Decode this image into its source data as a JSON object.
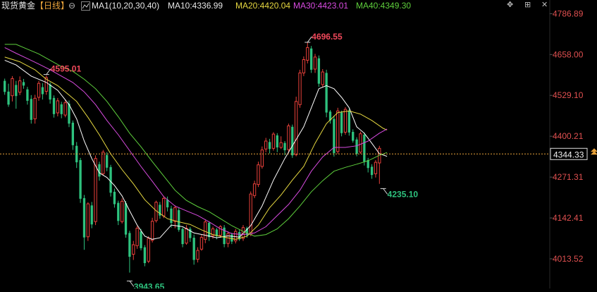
{
  "header": {
    "symbol": "现货黄金",
    "period": "【日线】",
    "period_toggle_glyph": "⊖",
    "indicator_icon": "ma-indicator-icon",
    "indicator": "MA1(10,20,30,40)",
    "ma10": "MA10:4336.99",
    "ma20": "MA20:4420.04",
    "ma30": "MA30:4423.01",
    "ma40": "MA40:4349.30",
    "controls": [
      "✥",
      "⊞",
      "✕"
    ]
  },
  "colors": {
    "background": "#000000",
    "up": "#e8403a",
    "down": "#2ec27e",
    "ma10": "#ffffff",
    "ma20": "#e6d840",
    "ma30": "#d84be0",
    "ma40": "#5ecf3c",
    "axis_text": "#e05050",
    "price_line": "#e8a23a",
    "high_label": "#f0485a",
    "low_label": "#2ec27e"
  },
  "chart_data": {
    "type": "candlestick",
    "ylim": [
      3920,
      4830
    ],
    "y_ticks": [
      "4786.89",
      "4658.00",
      "4529.10",
      "4400.21",
      "4271.31",
      "4142.41",
      "4013.52"
    ],
    "current_price": "4344.33",
    "candles": [
      [
        4575,
        4540,
        4582,
        4531
      ],
      [
        4541,
        4500,
        4566,
        4493
      ],
      [
        4528,
        4582,
        4590,
        4510
      ],
      [
        4562,
        4527,
        4575,
        4487
      ],
      [
        4539,
        4575,
        4589,
        4530
      ],
      [
        4571,
        4560,
        4581,
        4550
      ],
      [
        4548,
        4512,
        4556,
        4500
      ],
      [
        4518,
        4452,
        4530,
        4440
      ],
      [
        4455,
        4520,
        4531,
        4440
      ],
      [
        4523,
        4567,
        4575,
        4512
      ],
      [
        4555,
        4533,
        4568,
        4516
      ],
      [
        4542,
        4585,
        4592,
        4531
      ],
      [
        4563,
        4516,
        4570,
        4503
      ],
      [
        4521,
        4470,
        4529,
        4459
      ],
      [
        4474,
        4512,
        4521,
        4463
      ],
      [
        4501,
        4470,
        4509,
        4457
      ],
      [
        4467,
        4506,
        4516,
        4460
      ],
      [
        4503,
        4440,
        4513,
        4429
      ],
      [
        4443,
        4372,
        4450,
        4357
      ],
      [
        4370,
        4318,
        4382,
        4300
      ],
      [
        4325,
        4203,
        4332,
        4190
      ],
      [
        4205,
        4081,
        4215,
        4042
      ],
      [
        4083,
        4187,
        4192,
        4070
      ],
      [
        4182,
        4122,
        4193,
        4110
      ],
      [
        4131,
        4330,
        4340,
        4120
      ],
      [
        4312,
        4273,
        4320,
        4260
      ],
      [
        4282,
        4350,
        4357,
        4276
      ],
      [
        4341,
        4301,
        4350,
        4290
      ],
      [
        4303,
        4222,
        4310,
        4210
      ],
      [
        4225,
        4186,
        4235,
        4175
      ],
      [
        4190,
        4133,
        4197,
        4120
      ],
      [
        4131,
        4195,
        4204,
        4125
      ],
      [
        4189,
        4090,
        4196,
        4080
      ],
      [
        4095,
        4020,
        4102,
        3970
      ],
      [
        4028,
        4058,
        4070,
        4010
      ],
      [
        4055,
        4110,
        4117,
        4045
      ],
      [
        4100,
        4047,
        4108,
        4040
      ],
      [
        4050,
        4000,
        4057,
        3990
      ],
      [
        4006,
        4078,
        4085,
        4000
      ],
      [
        4072,
        4132,
        4143,
        4065
      ],
      [
        4134,
        4192,
        4197,
        4128
      ],
      [
        4184,
        4150,
        4193,
        4140
      ],
      [
        4149,
        4204,
        4212,
        4142
      ],
      [
        4200,
        4176,
        4210,
        4163
      ],
      [
        4172,
        4127,
        4181,
        4112
      ],
      [
        4131,
        4175,
        4182,
        4110
      ],
      [
        4167,
        4105,
        4175,
        4099
      ],
      [
        4108,
        4060,
        4112,
        4050
      ],
      [
        4063,
        4110,
        4120,
        4058
      ],
      [
        4108,
        4079,
        4114,
        4067
      ],
      [
        4080,
        4010,
        4090,
        3995
      ],
      [
        4012,
        4040,
        4050,
        4002
      ],
      [
        4044,
        4081,
        4090,
        4039
      ],
      [
        4075,
        4130,
        4138,
        4063
      ],
      [
        4127,
        4082,
        4131,
        4070
      ],
      [
        4086,
        4108,
        4115,
        4077
      ],
      [
        4106,
        4085,
        4111,
        4075
      ],
      [
        4088,
        4115,
        4120,
        4080
      ],
      [
        4112,
        4060,
        4120,
        4050
      ],
      [
        4062,
        4093,
        4100,
        4050
      ],
      [
        4090,
        4068,
        4096,
        4060
      ],
      [
        4070,
        4100,
        4108,
        4062
      ],
      [
        4098,
        4075,
        4105,
        4070
      ],
      [
        4078,
        4112,
        4120,
        4070
      ],
      [
        4110,
        4088,
        4115,
        4080
      ],
      [
        4090,
        4218,
        4226,
        4085
      ],
      [
        4213,
        4250,
        4260,
        4205
      ],
      [
        4248,
        4310,
        4320,
        4240
      ],
      [
        4305,
        4357,
        4368,
        4298
      ],
      [
        4360,
        4385,
        4395,
        4350
      ],
      [
        4382,
        4360,
        4392,
        4346
      ],
      [
        4362,
        4407,
        4413,
        4355
      ],
      [
        4403,
        4365,
        4410,
        4350
      ],
      [
        4365,
        4380,
        4400,
        4360
      ],
      [
        4379,
        4356,
        4385,
        4340
      ],
      [
        4358,
        4433,
        4440,
        4347
      ],
      [
        4430,
        4340,
        4437,
        4332
      ],
      [
        4342,
        4510,
        4525,
        4337
      ],
      [
        4500,
        4600,
        4610,
        4490
      ],
      [
        4600,
        4642,
        4652,
        4590
      ],
      [
        4640,
        4680,
        4696,
        4630
      ],
      [
        4677,
        4610,
        4685,
        4600
      ],
      [
        4612,
        4650,
        4660,
        4600
      ],
      [
        4646,
        4566,
        4655,
        4556
      ],
      [
        4563,
        4603,
        4612,
        4555
      ],
      [
        4600,
        4475,
        4610,
        4460
      ],
      [
        4478,
        4450,
        4483,
        4440
      ],
      [
        4455,
        4347,
        4465,
        4336
      ],
      [
        4352,
        4480,
        4490,
        4345
      ],
      [
        4475,
        4410,
        4481,
        4400
      ],
      [
        4413,
        4485,
        4492,
        4405
      ],
      [
        4481,
        4412,
        4488,
        4402
      ],
      [
        4414,
        4386,
        4422,
        4380
      ],
      [
        4390,
        4345,
        4397,
        4337
      ],
      [
        4350,
        4408,
        4415,
        4345
      ],
      [
        4405,
        4320,
        4412,
        4308
      ],
      [
        4325,
        4300,
        4332,
        4286
      ],
      [
        4304,
        4278,
        4312,
        4266
      ],
      [
        4282,
        4318,
        4325,
        4270
      ],
      [
        4316,
        4362,
        4370,
        4250
      ]
    ],
    "ma": [
      {
        "name": "MA10",
        "values": [
          [
            0,
            4640
          ],
          [
            3,
            4625
          ],
          [
            7,
            4590
          ],
          [
            11,
            4570
          ],
          [
            14,
            4545
          ],
          [
            17,
            4500
          ],
          [
            19,
            4455
          ],
          [
            21,
            4385
          ],
          [
            23,
            4330
          ],
          [
            25,
            4285
          ],
          [
            27,
            4270
          ],
          [
            29,
            4245
          ],
          [
            31,
            4212
          ],
          [
            33,
            4165
          ],
          [
            35,
            4120
          ],
          [
            37,
            4085
          ],
          [
            39,
            4075
          ],
          [
            41,
            4080
          ],
          [
            44,
            4120
          ],
          [
            47,
            4115
          ],
          [
            50,
            4095
          ],
          [
            53,
            4088
          ],
          [
            56,
            4080
          ],
          [
            59,
            4086
          ],
          [
            62,
            4082
          ],
          [
            65,
            4118
          ],
          [
            68,
            4180
          ],
          [
            71,
            4262
          ],
          [
            74,
            4330
          ],
          [
            77,
            4390
          ],
          [
            79,
            4430
          ],
          [
            81,
            4490
          ],
          [
            83,
            4550
          ],
          [
            85,
            4560
          ],
          [
            87,
            4550
          ],
          [
            89,
            4523
          ],
          [
            91,
            4490
          ],
          [
            93,
            4430
          ],
          [
            95,
            4410
          ],
          [
            97,
            4378
          ],
          [
            99,
            4345
          ],
          [
            101,
            4337
          ]
        ]
      },
      {
        "name": "MA20",
        "values": [
          [
            0,
            4650
          ],
          [
            4,
            4635
          ],
          [
            8,
            4610
          ],
          [
            11,
            4580
          ],
          [
            14,
            4560
          ],
          [
            17,
            4530
          ],
          [
            19,
            4510
          ],
          [
            22,
            4460
          ],
          [
            25,
            4405
          ],
          [
            28,
            4345
          ],
          [
            31,
            4295
          ],
          [
            34,
            4250
          ],
          [
            37,
            4200
          ],
          [
            40,
            4165
          ],
          [
            43,
            4140
          ],
          [
            46,
            4130
          ],
          [
            49,
            4122
          ],
          [
            52,
            4105
          ],
          [
            55,
            4090
          ],
          [
            58,
            4082
          ],
          [
            61,
            4075
          ],
          [
            64,
            4085
          ],
          [
            67,
            4120
          ],
          [
            70,
            4175
          ],
          [
            73,
            4215
          ],
          [
            76,
            4262
          ],
          [
            79,
            4305
          ],
          [
            82,
            4378
          ],
          [
            85,
            4440
          ],
          [
            88,
            4475
          ],
          [
            91,
            4480
          ],
          [
            94,
            4470
          ],
          [
            97,
            4450
          ],
          [
            100,
            4425
          ],
          [
            101,
            4420
          ]
        ]
      },
      {
        "name": "MA30",
        "values": [
          [
            0,
            4680
          ],
          [
            3,
            4662
          ],
          [
            6,
            4645
          ],
          [
            9,
            4628
          ],
          [
            12,
            4610
          ],
          [
            15,
            4590
          ],
          [
            18,
            4570
          ],
          [
            21,
            4540
          ],
          [
            24,
            4500
          ],
          [
            27,
            4450
          ],
          [
            30,
            4405
          ],
          [
            33,
            4355
          ],
          [
            36,
            4305
          ],
          [
            39,
            4258
          ],
          [
            42,
            4210
          ],
          [
            45,
            4180
          ],
          [
            48,
            4165
          ],
          [
            51,
            4150
          ],
          [
            54,
            4130
          ],
          [
            57,
            4108
          ],
          [
            60,
            4093
          ],
          [
            63,
            4090
          ],
          [
            66,
            4095
          ],
          [
            69,
            4115
          ],
          [
            72,
            4150
          ],
          [
            75,
            4185
          ],
          [
            78,
            4230
          ],
          [
            81,
            4290
          ],
          [
            84,
            4335
          ],
          [
            87,
            4365
          ],
          [
            90,
            4365
          ],
          [
            93,
            4370
          ],
          [
            96,
            4385
          ],
          [
            99,
            4410
          ],
          [
            101,
            4423
          ]
        ]
      },
      {
        "name": "MA40",
        "values": [
          [
            0,
            4690
          ],
          [
            3,
            4690
          ],
          [
            6,
            4675
          ],
          [
            9,
            4660
          ],
          [
            12,
            4640
          ],
          [
            15,
            4620
          ],
          [
            18,
            4605
          ],
          [
            21,
            4580
          ],
          [
            24,
            4550
          ],
          [
            27,
            4510
          ],
          [
            30,
            4462
          ],
          [
            33,
            4410
          ],
          [
            36,
            4367
          ],
          [
            39,
            4320
          ],
          [
            42,
            4275
          ],
          [
            45,
            4230
          ],
          [
            48,
            4198
          ],
          [
            51,
            4178
          ],
          [
            54,
            4162
          ],
          [
            57,
            4140
          ],
          [
            60,
            4118
          ],
          [
            63,
            4100
          ],
          [
            66,
            4085
          ],
          [
            69,
            4090
          ],
          [
            72,
            4108
          ],
          [
            75,
            4140
          ],
          [
            78,
            4180
          ],
          [
            81,
            4225
          ],
          [
            84,
            4260
          ],
          [
            87,
            4290
          ],
          [
            90,
            4302
          ],
          [
            93,
            4312
          ],
          [
            96,
            4323
          ],
          [
            99,
            4340
          ],
          [
            101,
            4349
          ]
        ]
      }
    ],
    "annotations": [
      {
        "text": "4696.55",
        "index": 80,
        "price": 4696.55,
        "kind": "high"
      },
      {
        "text": "4595.01",
        "index": 11,
        "price": 4595.01,
        "kind": "high"
      },
      {
        "text": "3943.65",
        "index": 33,
        "price": 3943.65,
        "kind": "low"
      },
      {
        "text": "4235.10",
        "index": 100,
        "price": 4235.1,
        "kind": "low"
      }
    ]
  }
}
